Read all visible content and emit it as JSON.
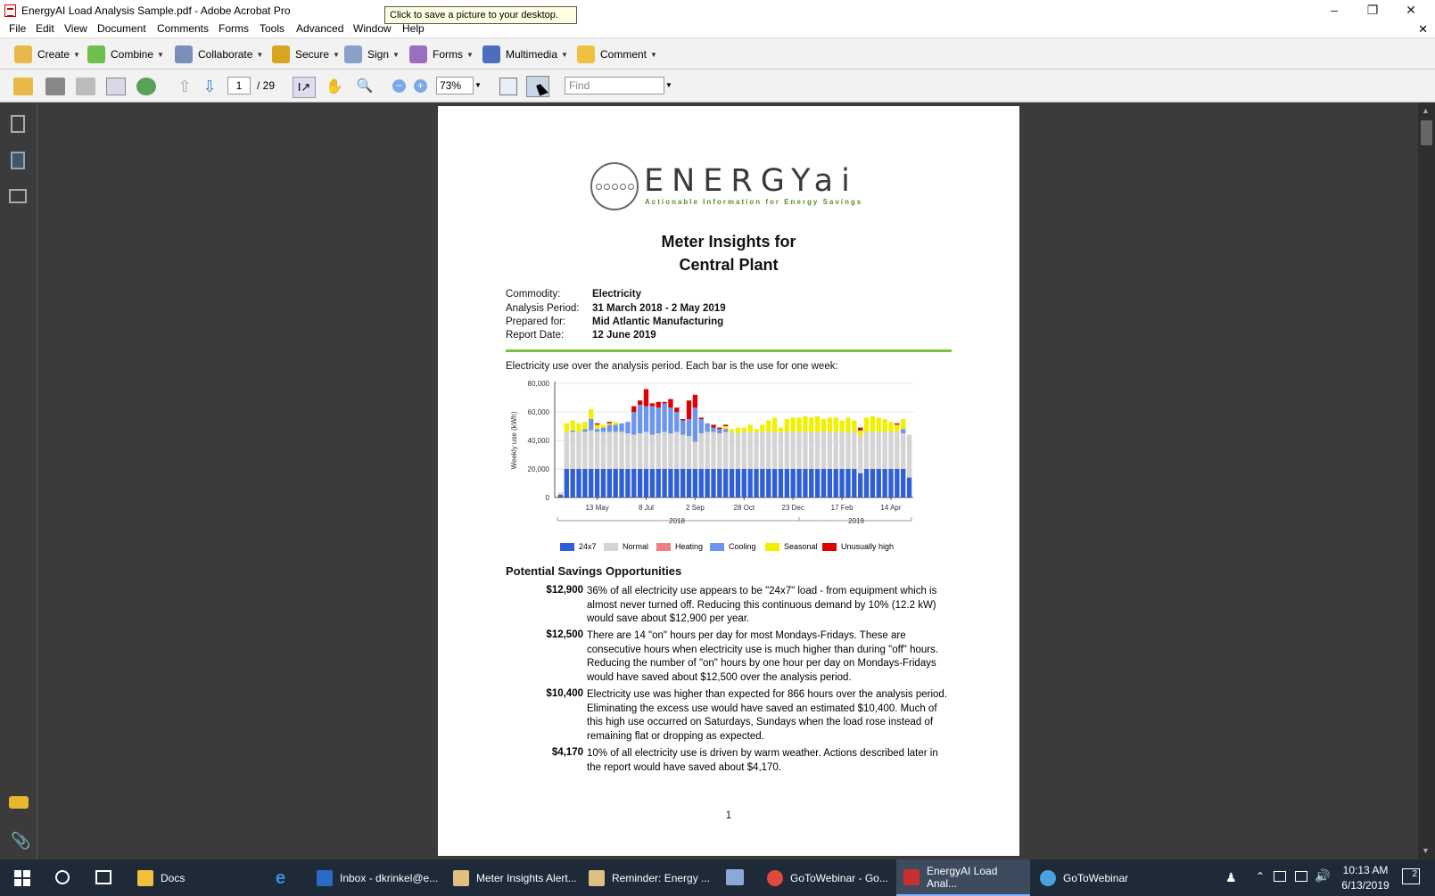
{
  "window": {
    "title": "EnergyAI Load Analysis Sample.pdf - Adobe Acrobat Pro",
    "tooltip": "Click to save a picture to your desktop."
  },
  "menu": [
    "File",
    "Edit",
    "View",
    "Document",
    "Comments",
    "Forms",
    "Tools",
    "Advanced",
    "Window",
    "Help"
  ],
  "tasks": [
    "Create",
    "Combine",
    "Collaborate",
    "Secure",
    "Sign",
    "Forms",
    "Multimedia",
    "Comment"
  ],
  "toolbar": {
    "page_current": "1",
    "page_total": "/ 29",
    "zoom": "73%",
    "find_placeholder": "Find"
  },
  "document": {
    "logo_text": "ENERGYai",
    "logo_tagline": "Actionable Information for Energy Savings",
    "title_line1": "Meter Insights for",
    "title_line2": "Central Plant",
    "meta": [
      {
        "label": "Commodity:",
        "value": "Electricity"
      },
      {
        "label": "Analysis Period:",
        "value": "31 March 2018 - 2 May 2019"
      },
      {
        "label": "Prepared for:",
        "value": "Mid Atlantic Manufacturing"
      },
      {
        "label": "Report Date:",
        "value": "12 June 2019"
      }
    ],
    "chart_intro": "Electricity use over the analysis period. Each bar is the use for one week:",
    "savings_heading": "Potential Savings Opportunities",
    "savings": [
      {
        "amount": "$12,900",
        "text": "36% of all electricity use appears to be \"24x7\" load - from equipment which is almost never turned off.  Reducing this continuous demand by 10% (12.2 kW) would save about $12,900 per year."
      },
      {
        "amount": "$12,500",
        "text": "There are 14 \"on\" hours per day for most Mondays-Fridays. These are consecutive hours when electricity use is much higher than during \"off\" hours. Reducing the number of \"on\" hours by one hour per day on Mondays-Fridays would have saved about $12,500 over the analysis period."
      },
      {
        "amount": "$10,400",
        "text": "Electricity use was higher than expected for 866 hours over the analysis period. Eliminating the excess use would have saved an estimated $10,400. Much of this high use occurred on Saturdays, Sundays when the load rose instead of remaining flat or dropping as expected."
      },
      {
        "amount": "$4,170",
        "text": "10% of all electricity use is driven by warm weather. Actions described later in the report would have saved about $4,170."
      }
    ],
    "page_number": "1"
  },
  "chart_data": {
    "type": "bar",
    "stacked": true,
    "ylabel": "Weekly use (kWh)",
    "ylim": [
      0,
      80000
    ],
    "yticks": [
      "0",
      "20,000",
      "40,000",
      "60,000",
      "80,000"
    ],
    "xticks": [
      "13 May",
      "8 Jul",
      "2 Sep",
      "28 Oct",
      "23 Dec",
      "17 Feb",
      "14 Apr"
    ],
    "year_labels": [
      "2018",
      "2019"
    ],
    "legend": [
      "24x7",
      "Normal",
      "Heating",
      "Cooling",
      "Seasonal",
      "Unusually high"
    ],
    "colors": {
      "24x7": "#2f5fd6",
      "Normal": "#d4d4d4",
      "Heating": "#f08080",
      "Cooling": "#6b95ee",
      "Seasonal": "#f0f000",
      "Unusually high": "#e00000"
    },
    "weeks": [
      [
        2000,
        1500,
        0,
        0,
        0,
        0
      ],
      [
        20000,
        26000,
        0,
        0,
        6000,
        0
      ],
      [
        20000,
        26000,
        0,
        1000,
        7000,
        0
      ],
      [
        20000,
        26000,
        0,
        0,
        6000,
        0
      ],
      [
        20000,
        26000,
        0,
        2000,
        5000,
        0
      ],
      [
        20000,
        27000,
        0,
        8000,
        7000,
        0
      ],
      [
        20000,
        26000,
        0,
        2000,
        3000,
        1000
      ],
      [
        20000,
        26000,
        0,
        3000,
        2000,
        0
      ],
      [
        20000,
        26000,
        0,
        5000,
        1000,
        1000
      ],
      [
        20000,
        26000,
        0,
        5000,
        2000,
        0
      ],
      [
        20000,
        26000,
        0,
        6000,
        0,
        0
      ],
      [
        20000,
        25000,
        0,
        8000,
        0,
        0
      ],
      [
        20000,
        24000,
        0,
        16000,
        0,
        4000
      ],
      [
        20000,
        25000,
        0,
        20000,
        0,
        3000
      ],
      [
        20000,
        26000,
        0,
        18000,
        0,
        12000
      ],
      [
        20000,
        24000,
        0,
        20000,
        0,
        2000
      ],
      [
        20000,
        25000,
        0,
        18000,
        0,
        4000
      ],
      [
        20000,
        26000,
        0,
        20000,
        0,
        1000
      ],
      [
        20000,
        25000,
        0,
        18000,
        0,
        6000
      ],
      [
        20000,
        26000,
        0,
        14000,
        0,
        3000
      ],
      [
        20000,
        24000,
        0,
        10000,
        0,
        1000
      ],
      [
        20000,
        23000,
        0,
        12000,
        0,
        13000
      ],
      [
        20000,
        19000,
        0,
        24000,
        0,
        9000
      ],
      [
        20000,
        25000,
        0,
        10000,
        0,
        1000
      ],
      [
        20000,
        26000,
        0,
        6000,
        0,
        0
      ],
      [
        20000,
        26000,
        0,
        3000,
        0,
        2000
      ],
      [
        20000,
        25000,
        0,
        3000,
        0,
        1000
      ],
      [
        20000,
        26000,
        0,
        2000,
        2000,
        1000
      ],
      [
        20000,
        26000,
        0,
        0,
        2000,
        0
      ],
      [
        20000,
        25000,
        0,
        0,
        4000,
        0
      ],
      [
        20000,
        26000,
        0,
        0,
        3000,
        0
      ],
      [
        20000,
        26000,
        0,
        0,
        5000,
        0
      ],
      [
        20000,
        26000,
        0,
        0,
        2000,
        0
      ],
      [
        20000,
        26000,
        0,
        0,
        5000,
        0
      ],
      [
        20000,
        26000,
        0,
        0,
        8000,
        0
      ],
      [
        20000,
        26000,
        0,
        0,
        10000,
        0
      ],
      [
        20000,
        26000,
        0,
        0,
        3000,
        0
      ],
      [
        20000,
        26000,
        0,
        0,
        9000,
        0
      ],
      [
        20000,
        26000,
        0,
        0,
        10000,
        0
      ],
      [
        20000,
        26000,
        0,
        0,
        10000,
        0
      ],
      [
        20000,
        26000,
        0,
        0,
        11000,
        0
      ],
      [
        20000,
        26000,
        0,
        0,
        10000,
        0
      ],
      [
        20000,
        26000,
        0,
        0,
        11000,
        0
      ],
      [
        20000,
        26000,
        0,
        0,
        9000,
        0
      ],
      [
        20000,
        26000,
        0,
        0,
        10000,
        0
      ],
      [
        20000,
        26000,
        0,
        0,
        10000,
        0
      ],
      [
        20000,
        26000,
        0,
        0,
        8000,
        0
      ],
      [
        20000,
        26000,
        0,
        0,
        10000,
        0
      ],
      [
        20000,
        26000,
        0,
        0,
        8000,
        0
      ],
      [
        17000,
        26000,
        0,
        0,
        4000,
        2000
      ],
      [
        20000,
        26000,
        0,
        0,
        10000,
        0
      ],
      [
        20000,
        26000,
        0,
        0,
        11000,
        0
      ],
      [
        20000,
        26000,
        0,
        0,
        10000,
        0
      ],
      [
        20000,
        26000,
        0,
        0,
        9000,
        0
      ],
      [
        20000,
        26000,
        0,
        0,
        7000,
        0
      ],
      [
        20000,
        26000,
        0,
        0,
        5000,
        1000
      ],
      [
        20000,
        25000,
        0,
        3000,
        7000,
        0
      ],
      [
        14000,
        30000,
        0,
        0,
        0,
        0
      ]
    ]
  },
  "taskbar": {
    "apps": [
      "Docs",
      "Inbox - dkrinkel@e...",
      "Meter Insights Alert...",
      "Reminder: Energy ...",
      "GoToWebinar - Go...",
      "EnergyAI Load Anal...",
      "GoToWebinar"
    ],
    "time": "10:13 AM",
    "date": "6/13/2019",
    "notification_count": "2"
  }
}
